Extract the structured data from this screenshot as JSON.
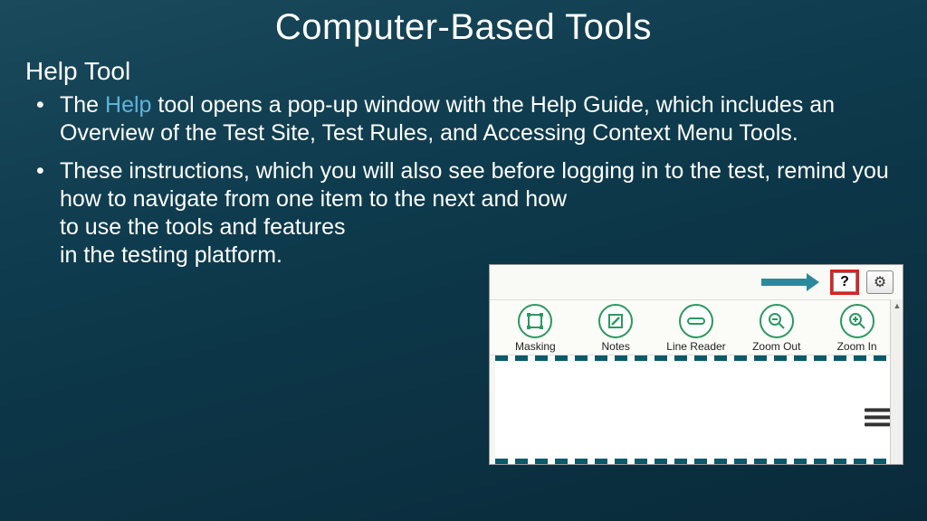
{
  "title": "Computer-Based Tools",
  "subtitle": "Help Tool",
  "bullet1": {
    "pre": "The ",
    "link": "Help",
    "post": " tool opens a pop-up window with the Help Guide, which includes an Overview of the Test Site, Test Rules, and Accessing Context Menu Tools."
  },
  "bullet2": {
    "line1": "These instructions, which you will also see before logging in to the test, remind you how to navigate from one item to the next and how",
    "line2": "to use the tools and features",
    "line3": "in the testing platform."
  },
  "toolbar": {
    "help_symbol": "?",
    "gear_symbol": "⚙",
    "tools": [
      {
        "label": "Masking",
        "icon": "masking-icon"
      },
      {
        "label": "Notes",
        "icon": "notes-icon"
      },
      {
        "label": "Line Reader",
        "icon": "line-reader-icon"
      },
      {
        "label": "Zoom Out",
        "icon": "zoom-out-icon"
      },
      {
        "label": "Zoom In",
        "icon": "zoom-in-icon"
      }
    ]
  }
}
